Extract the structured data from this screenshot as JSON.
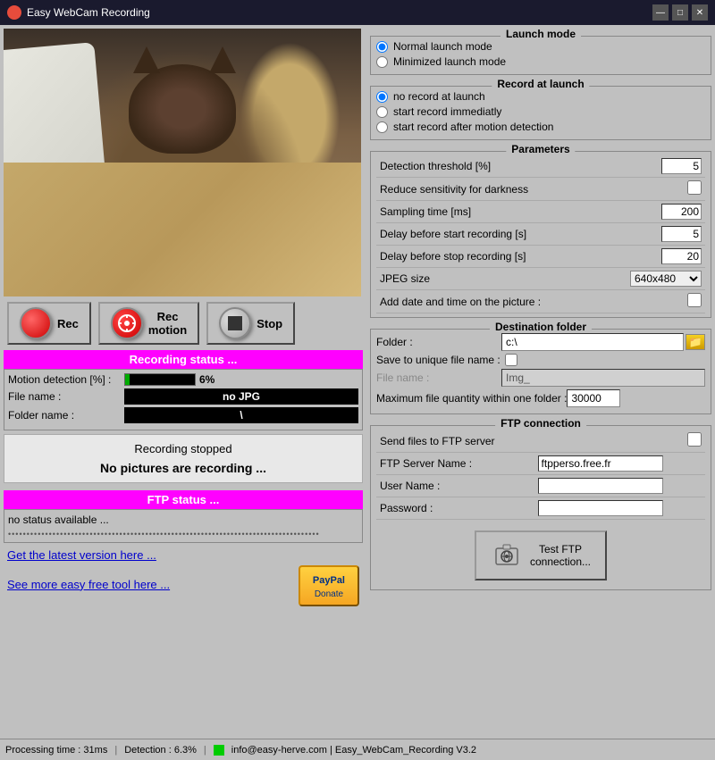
{
  "app": {
    "title": "Easy WebCam Recording"
  },
  "titlebar": {
    "minimize_label": "—",
    "maximize_label": "□",
    "close_label": "✕"
  },
  "launch_mode": {
    "title": "Launch mode",
    "option1": "Normal launch mode",
    "option2": "Minimized launch mode"
  },
  "record_at_launch": {
    "title": "Record at launch",
    "option1": "no record at launch",
    "option2": "start record immediatly",
    "option3": "start record after motion detection"
  },
  "parameters": {
    "title": "Parameters",
    "detection_threshold_label": "Detection threshold [%]",
    "detection_threshold_val": "5",
    "reduce_sensitivity_label": "Reduce sensitivity for darkness",
    "sampling_time_label": "Sampling time [ms]",
    "sampling_time_val": "200",
    "delay_start_label": "Delay before start recording [s]",
    "delay_start_val": "5",
    "delay_stop_label": "Delay before stop recording [s]",
    "delay_stop_val": "20",
    "jpeg_size_label": "JPEG size",
    "jpeg_size_val": "640x480",
    "add_date_label": "Add date and time on the picture :"
  },
  "destination": {
    "title": "Destination folder",
    "folder_label": "Folder :",
    "folder_val": "c:\\",
    "unique_file_label": "Save to unique file name :",
    "file_name_label": "File name :",
    "file_name_val": "Img_",
    "max_files_label": "Maximum file quantity within one folder :",
    "max_files_val": "30000"
  },
  "ftp_connection": {
    "title": "FTP connection",
    "send_files_label": "Send files to FTP server",
    "server_name_label": "FTP Server Name :",
    "server_name_val": "ftpperso.free.fr",
    "user_name_label": "User Name :",
    "user_name_val": "",
    "password_label": "Password :",
    "password_val": "",
    "test_btn_label": "Test FTP\nconnection..."
  },
  "controls": {
    "rec_label": "Rec",
    "rec_motion_label": "Rec\nmotion",
    "stop_label": "Stop"
  },
  "recording_status": {
    "bar_label": "Recording status ...",
    "motion_label": "Motion detection [%] :",
    "motion_val": "6%",
    "motion_pct": 6,
    "file_name_label": "File name :",
    "file_name_val": "no JPG",
    "folder_name_label": "Folder name :",
    "folder_name_val": "\\",
    "stopped_text": "Recording stopped",
    "no_pictures_text": "No pictures are recording ..."
  },
  "ftp_status": {
    "bar_label": "FTP status ...",
    "status_text": "no status available ...",
    "dots": "••••••••••••••••••••••••••••••••••••••••••••••••••••••••••••••••••••••••••••••••••••"
  },
  "links": {
    "latest_version": "Get the latest version here ...",
    "more_tools": "See more easy free tool here ...",
    "paypal": "PayPal\nDonate"
  },
  "status_bar": {
    "processing": "Processing time : 31ms",
    "detection": "Detection : 6.3%",
    "email": "info@easy-herve.com | Easy_WebCam_Recording V3.2"
  }
}
